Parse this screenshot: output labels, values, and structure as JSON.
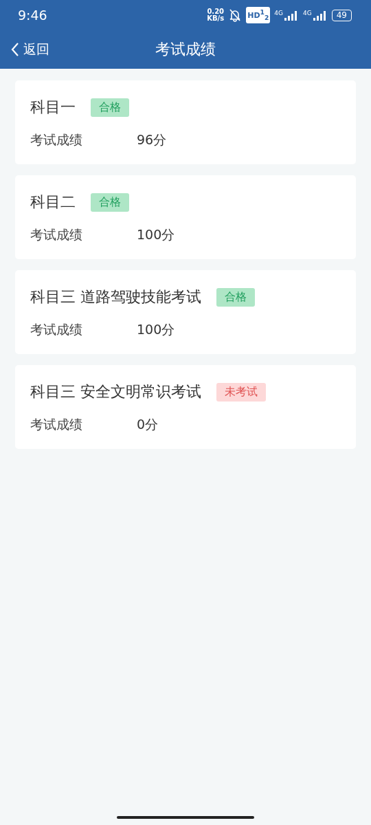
{
  "status_bar": {
    "time": "9:46",
    "net_speed": "0.20",
    "net_unit": "KB/s",
    "hd_badge": "HD$^{1}$$_{2}$",
    "sim1_label": "4G",
    "sim2_label": "4G",
    "battery": "49"
  },
  "nav": {
    "back_label": "返回",
    "title": "考试成绩"
  },
  "results": [
    {
      "subject": "科目一",
      "tag": "合格",
      "kind": "pass",
      "label": "考试成绩",
      "score": "96分"
    },
    {
      "subject": "科目二",
      "tag": "合格",
      "kind": "pass",
      "label": "考试成绩",
      "score": "100分"
    },
    {
      "subject": "科目三 道路驾驶技能考试",
      "tag": "合格",
      "kind": "pass",
      "label": "考试成绩",
      "score": "100分"
    },
    {
      "subject": "科目三 安全文明常识考试",
      "tag": "未考试",
      "kind": "absent",
      "label": "考试成绩",
      "score": "0分"
    }
  ]
}
